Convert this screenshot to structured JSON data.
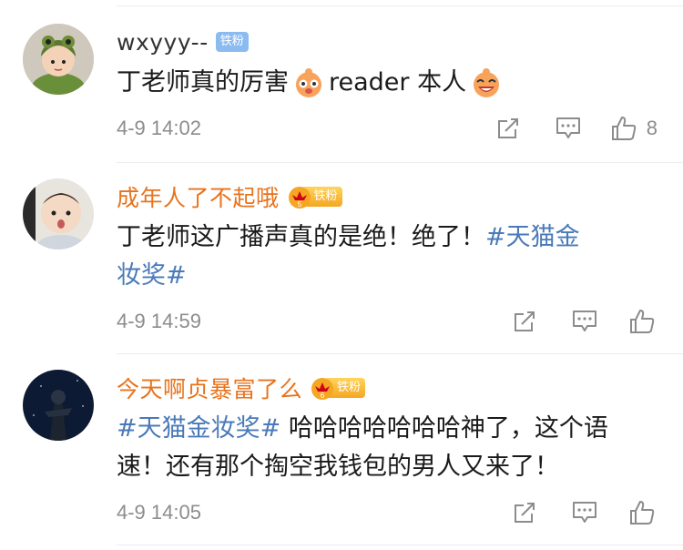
{
  "comments": [
    {
      "username": "wxyyy--",
      "username_color": "#333333",
      "badge_text": "铁粉",
      "badge_type": "plain",
      "text_part1": "丁老师真的厉害",
      "text_part2": "reader 本人",
      "emoji_1": "doge-face-icon",
      "emoji_2": "laughing-doge-icon",
      "time": "4-9 14:02",
      "like_count": "8"
    },
    {
      "username": "成年人了不起哦",
      "username_color": "#e8731c",
      "badge_text": "铁粉",
      "badge_level": "5",
      "badge_type": "crown",
      "text_line1": "丁老师这广播声真的是绝！绝了！",
      "hashtag_part1": "#天猫金",
      "hashtag_part2": "妆奖#",
      "time": "4-9 14:59"
    },
    {
      "username": "今天啊贞暴富了么",
      "username_color": "#e8731c",
      "badge_text": "铁粉",
      "badge_level": "6",
      "badge_type": "crown",
      "hashtag": "#天猫金妆奖#",
      "text_after_hashtag": " 哈哈哈哈哈哈哈神了，这个语",
      "text_line2": "速！还有那个掏空我钱包的男人又来了！",
      "time": "4-9 14:05"
    }
  ],
  "icons": {
    "share": "share-icon",
    "comment": "comment-icon",
    "like": "like-icon"
  },
  "colors": {
    "hashtag": "#4a7ab8",
    "meta": "#8c8c8c",
    "orange_name": "#e8731c",
    "badge_blue": "#8cbbf0",
    "badge_gold": "#f5a623"
  }
}
